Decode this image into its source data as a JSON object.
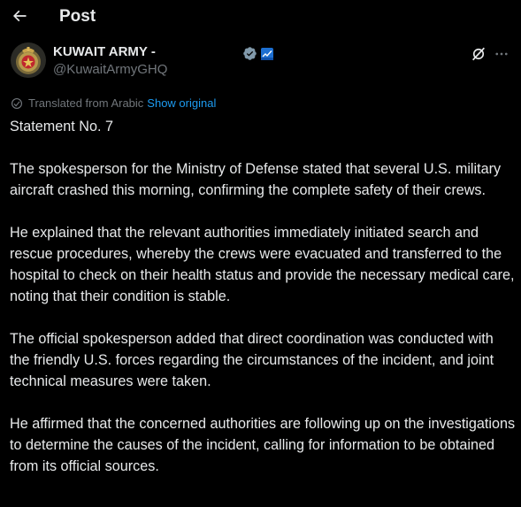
{
  "header": {
    "title": "Post",
    "back_icon": "back-arrow-icon"
  },
  "author": {
    "display_name": "KUWAIT ARMY -",
    "handle": "@KuwaitArmyGHQ",
    "avatar_icon": "army-emblem-icon",
    "verified_icon": "government-verified-badge-icon",
    "affiliate_icon": "affiliate-flag-icon"
  },
  "actions": {
    "grok_icon": "grok-icon",
    "more_icon": "more-options-icon"
  },
  "translation": {
    "label": "Translated from Arabic",
    "link": "Show original"
  },
  "post": {
    "paragraphs": [
      "Statement No. 7",
      "The spokesperson for the Ministry of Defense stated that several U.S. military aircraft crashed this morning, confirming the complete safety of their crews.",
      "He explained that the relevant authorities immediately initiated search and rescue procedures, whereby the crews were evacuated and transferred to the hospital to check on their health status and provide the necessary medical care, noting that their condition is stable.",
      "The official spokesperson added that direct coordination was conducted with the friendly U.S. forces regarding the circumstances of the incident, and joint technical measures were taken.",
      "He affirmed that the concerned authorities are following up on the investigations to determine the causes of the incident, calling for information to be obtained from its official sources."
    ]
  },
  "colors": {
    "background": "#000000",
    "text_primary": "#e7e9ea",
    "text_secondary": "#71767b",
    "link": "#1d9bf0",
    "verified_badge": "#829aab"
  }
}
